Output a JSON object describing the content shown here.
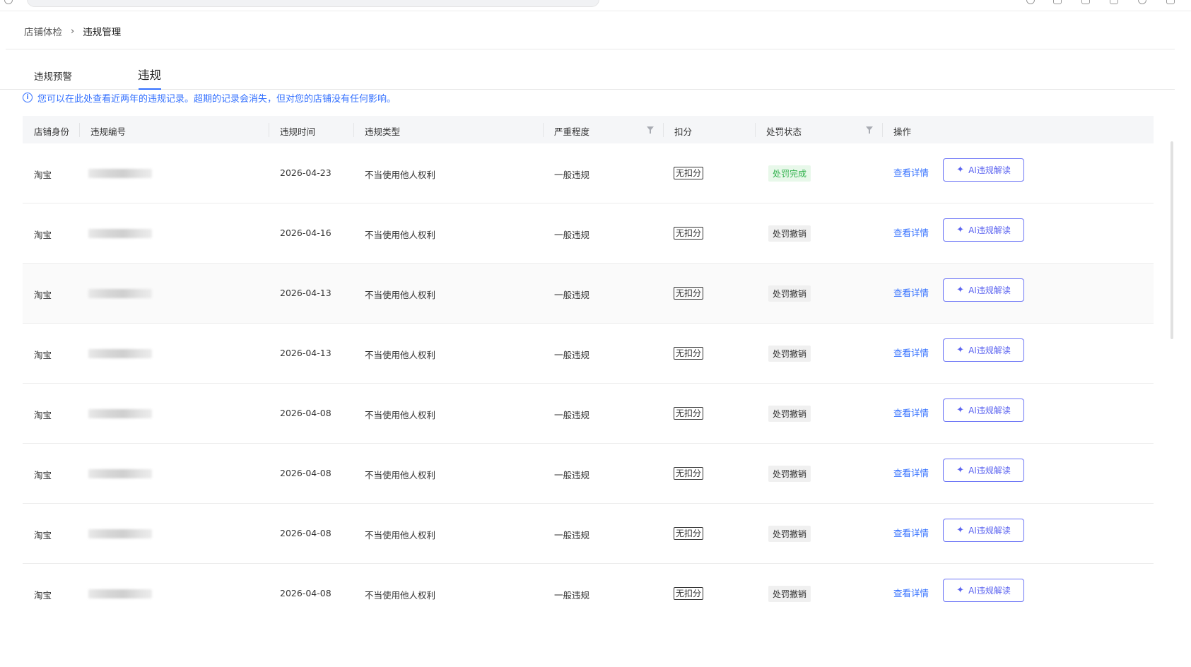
{
  "breadcrumb": {
    "parent": "店铺体检",
    "separator": "›",
    "current": "违规管理"
  },
  "tabs": [
    {
      "label": "违规预警",
      "active": false
    },
    {
      "label": "违规",
      "active": true
    }
  ],
  "notice": {
    "icon": "info-icon",
    "text": "您可以在此处查看近两年的违规记录。超期的记录会消失，但对您的店铺没有任何影响。"
  },
  "table": {
    "columns": {
      "shop": "店铺身份",
      "id": "违规编号",
      "time": "违规时间",
      "type": "违规类型",
      "severity": "严重程度",
      "score": "扣分",
      "status": "处罚状态",
      "action": "操作"
    },
    "rows": [
      {
        "shop": "淘宝",
        "time": "2026-04-23",
        "type": "不当使用他人权利",
        "severity": "一般违规",
        "score": "无扣分",
        "status": "处罚完成",
        "detail": "查看详情",
        "ai": "AI违规解读"
      },
      {
        "shop": "淘宝",
        "time": "2026-04-16",
        "type": "不当使用他人权利",
        "severity": "一般违规",
        "score": "无扣分",
        "status": "处罚撤销",
        "detail": "查看详情",
        "ai": "AI违规解读"
      },
      {
        "shop": "淘宝",
        "time": "2026-04-13",
        "type": "不当使用他人权利",
        "severity": "一般违规",
        "score": "无扣分",
        "status": "处罚撤销",
        "detail": "查看详情",
        "ai": "AI违规解读"
      },
      {
        "shop": "淘宝",
        "time": "2026-04-13",
        "type": "不当使用他人权利",
        "severity": "一般违规",
        "score": "无扣分",
        "status": "处罚撤销",
        "detail": "查看详情",
        "ai": "AI违规解读"
      },
      {
        "shop": "淘宝",
        "time": "2026-04-08",
        "type": "不当使用他人权利",
        "severity": "一般违规",
        "score": "无扣分",
        "status": "处罚撤销",
        "detail": "查看详情",
        "ai": "AI违规解读"
      },
      {
        "shop": "淘宝",
        "time": "2026-04-08",
        "type": "不当使用他人权利",
        "severity": "一般违规",
        "score": "无扣分",
        "status": "处罚撤销",
        "detail": "查看详情",
        "ai": "AI违规解读"
      },
      {
        "shop": "淘宝",
        "time": "2026-04-08",
        "type": "不当使用他人权利",
        "severity": "一般违规",
        "score": "无扣分",
        "status": "处罚撤销",
        "detail": "查看详情",
        "ai": "AI违规解读"
      },
      {
        "shop": "淘宝",
        "time": "2026-04-08",
        "type": "不当使用他人权利",
        "severity": "一般违规",
        "score": "无扣分",
        "status": "处罚撤销",
        "detail": "查看详情",
        "ai": "AI违规解读"
      }
    ]
  },
  "colors": {
    "accent": "#3370ff",
    "ai_button": "#5b63f0",
    "status_done_text": "#31b24d",
    "status_done_bg": "#e8f8ea",
    "status_revoked_bg": "#f0f0f0"
  }
}
